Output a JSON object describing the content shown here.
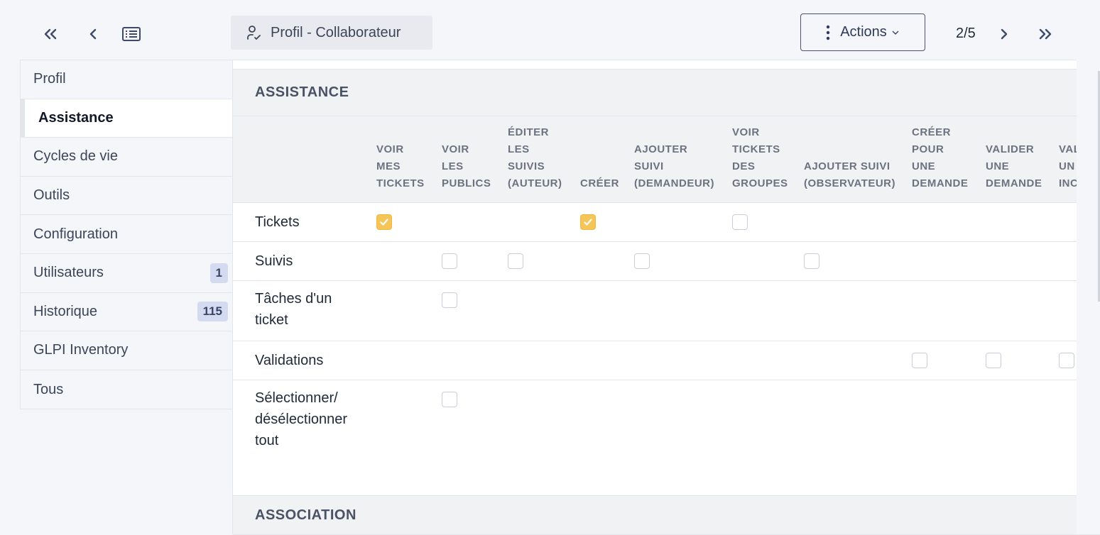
{
  "title": "Profil - Collaborateur",
  "actions_label": "Actions",
  "pager": "2/5",
  "icons": {
    "first": "double-chevron-left-icon",
    "prev": "chevron-left-icon",
    "list": "list-icon",
    "next": "chevron-right-icon",
    "last": "double-chevron-right-icon",
    "profile": "user-check-icon"
  },
  "colors": {
    "checked": "#f6c559",
    "badge_bg": "#d4dbf1"
  },
  "sidebar": {
    "items": [
      {
        "label": "Profil"
      },
      {
        "label": "Assistance",
        "active": true
      },
      {
        "label": "Cycles de vie"
      },
      {
        "label": "Outils"
      },
      {
        "label": "Configuration"
      },
      {
        "label": "Utilisateurs",
        "badge": "1"
      },
      {
        "label": "Historique",
        "badge": "115"
      },
      {
        "label": "GLPI Inventory"
      },
      {
        "label": "Tous"
      }
    ]
  },
  "section1": "ASSISTANCE",
  "section2": "ASSOCIATION",
  "columns": [
    "VOIR\nMES\nTICKETS",
    "VOIR\nLES\nPUBLICS",
    "ÉDITER\nLES\nSUIVIS\n(AUTEUR)",
    "CRÉER",
    "AJOUTER\nSUIVI\n(DEMANDEUR)",
    "VOIR\nTICKETS\nDES\nGROUPES",
    "AJOUTER SUIVI\n(OBSERVATEUR)",
    "CRÉER\nPOUR\nUNE\nDEMANDE",
    "VALIDER\nUNE\nDEMANDE",
    "VALIDER\nUN\nINCIDENT"
  ],
  "rows": [
    {
      "label": "Tickets",
      "checkboxes": [
        {
          "col": 0,
          "checked": true
        },
        {
          "col": 3,
          "checked": true
        },
        {
          "col": 5,
          "checked": false
        }
      ]
    },
    {
      "label": "Suivis",
      "checkboxes": [
        {
          "col": 1,
          "checked": false
        },
        {
          "col": 2,
          "checked": false
        },
        {
          "col": 4,
          "checked": false
        },
        {
          "col": 6,
          "checked": false
        }
      ]
    },
    {
      "label": "Tâches d'un\nticket",
      "checkboxes": [
        {
          "col": 1,
          "checked": false
        }
      ]
    },
    {
      "label": "Validations",
      "checkboxes": [
        {
          "col": 7,
          "checked": false
        },
        {
          "col": 8,
          "checked": false
        },
        {
          "col": 9,
          "checked": false
        }
      ]
    },
    {
      "label": "Sélectionner/\ndésélectionner\ntout",
      "checkboxes": [
        {
          "col": 1,
          "checked": false
        }
      ]
    }
  ]
}
